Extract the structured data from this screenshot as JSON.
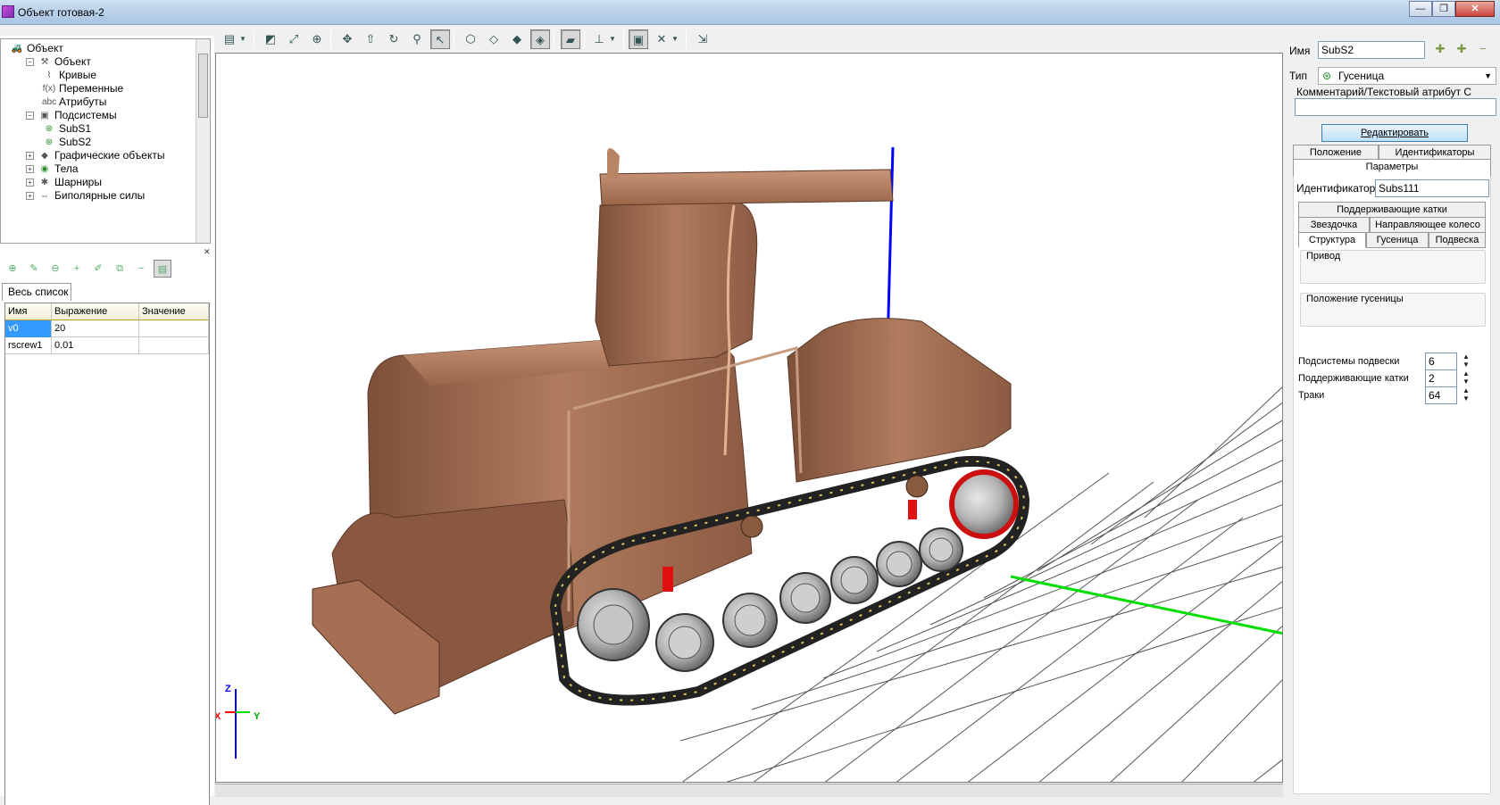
{
  "window": {
    "title": "Объект готовая-2",
    "minimize": "—",
    "restore": "❐",
    "close": "✕"
  },
  "tree": {
    "items": [
      {
        "label": "Объект",
        "icon": "car-icon",
        "expander": ""
      },
      {
        "label": "Объект",
        "icon": "hammer-icon",
        "expander": "−"
      },
      {
        "label": "Кривые",
        "icon": "curves-icon",
        "expander": ""
      },
      {
        "label": "Переменные",
        "icon": "function-icon",
        "expander": ""
      },
      {
        "label": "Атрибуты",
        "icon": "abc-icon",
        "expander": ""
      },
      {
        "label": "Подсистемы",
        "icon": "subsystems-icon",
        "expander": "−"
      },
      {
        "label": "SubS1",
        "icon": "track-icon",
        "expander": ""
      },
      {
        "label": "SubS2",
        "icon": "track-icon",
        "expander": ""
      },
      {
        "label": "Графические объекты",
        "icon": "graphics-icon",
        "expander": "+"
      },
      {
        "label": "Тела",
        "icon": "body-icon",
        "expander": "+"
      },
      {
        "label": "Шарниры",
        "icon": "joint-icon",
        "expander": "+"
      },
      {
        "label": "Биполярные силы",
        "icon": "bipolar-force-icon",
        "expander": "+"
      }
    ],
    "glyphs": {
      "car-icon": "🚜",
      "hammer-icon": "⚒",
      "curves-icon": "⌇",
      "function-icon": "f(x)",
      "abc-icon": "abc",
      "subsystems-icon": "▣",
      "track-icon": "⊛",
      "graphics-icon": "◆",
      "body-icon": "◉",
      "joint-icon": "✱",
      "bipolar-force-icon": "⇔"
    }
  },
  "variables": {
    "tab_label": "Весь список",
    "columns": [
      "Имя",
      "Выражение",
      "Значение"
    ],
    "rows": [
      {
        "name": "v0",
        "expression": "20",
        "value": ""
      },
      {
        "name": "rscrew1",
        "expression": "0.01",
        "value": ""
      }
    ]
  },
  "axes": {
    "x": "X",
    "y": "Y",
    "z": "Z"
  },
  "props": {
    "name_label": "Имя",
    "name_value": "SubS2",
    "type_label": "Тип",
    "type_value": "Гусеница",
    "comment_label": "Комментарий/Текстовый атрибут С",
    "comment_value": "",
    "edit_button": "Редактировать",
    "tabs_top": [
      "Положение",
      "Идентификаторы"
    ],
    "params_tab": "Параметры",
    "identifier_label": "Идентификатор",
    "identifier_value": "Subs111",
    "tabs_mid": [
      "Поддерживающие катки"
    ],
    "tabs_row2": [
      "Звездочка",
      "Направляющее колесо"
    ],
    "tabs_row3": [
      "Структура",
      "Гусеница",
      "Подвеска"
    ],
    "group_drive": "Привод",
    "group_track_pos": "Положение гусеницы",
    "fields": [
      {
        "label": "Подсистемы подвески",
        "value": "6"
      },
      {
        "label": "Поддерживающие катки",
        "value": "2"
      },
      {
        "label": "Траки",
        "value": "64"
      }
    ]
  },
  "colors": {
    "body": "#a8735a",
    "selection": "#3399ff",
    "axis_x": "#ff0000",
    "axis_y": "#00dd00",
    "axis_z": "#0000ff"
  }
}
